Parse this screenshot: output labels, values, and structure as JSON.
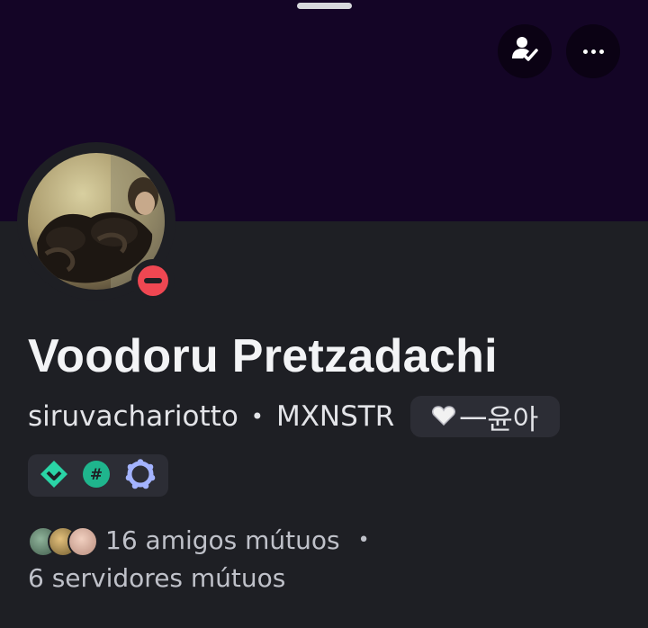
{
  "profile": {
    "display_name": "Voodoru Pretzadachi",
    "username": "siruvachariotto",
    "separator": "•",
    "server_tag": "MXNSTR",
    "guild_tag": {
      "emoji": "white-heart",
      "text": "一윤아"
    },
    "status": "do-not-disturb",
    "avatar": "avatar-photo"
  },
  "header": {
    "icons": [
      "add-friend-icon",
      "more-options-icon"
    ]
  },
  "badges": [
    "hypesquad-balance-icon",
    "nitro-hash-icon",
    "server-booster-icon"
  ],
  "mutual": {
    "friends_text": "16 amigos mútuos",
    "separator": "•",
    "servers_text": "6 servidores mútuos"
  },
  "colors": {
    "banner": "#140526",
    "background": "#1e1f24",
    "pill": "#2c2d35",
    "status_dnd": "#ef4752",
    "hypesquad": "#2ad4a6",
    "booster": "#a3b3ff"
  }
}
